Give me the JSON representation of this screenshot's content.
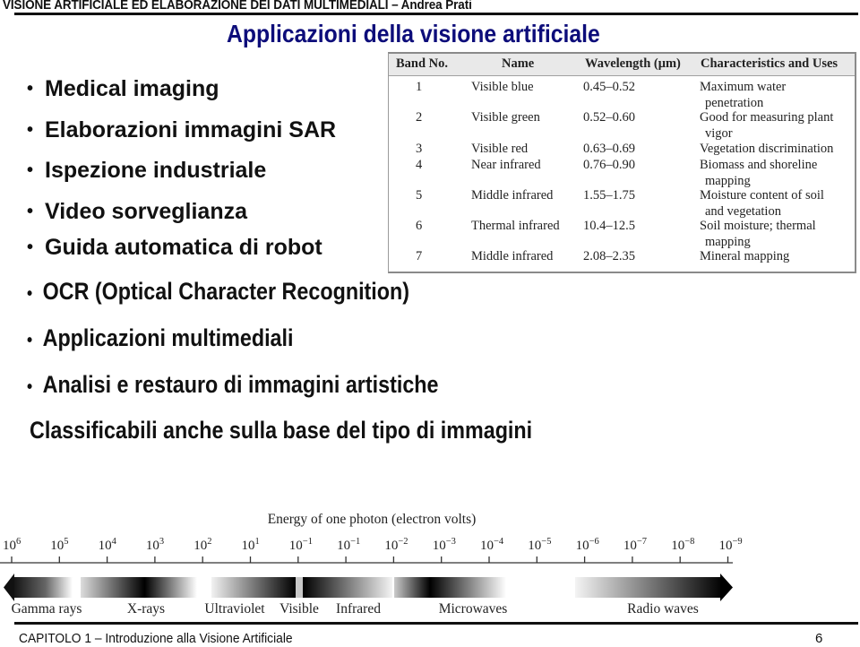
{
  "header": {
    "course_title": "VISIONE ARTIFICIALE ED ELABORAZIONE DEI DATI MULTIMEDIALI – Andrea Prati"
  },
  "slide": {
    "title": "Applicazioni della visione artificiale",
    "bullets_top": [
      "Medical imaging",
      "Elaborazioni immagini SAR",
      "Ispezione industriale",
      "Video sorveglianza",
      "Guida automatica di robot"
    ],
    "bullets_bottom": [
      "OCR (Optical Character Recognition)",
      "Applicazioni multimediali",
      "Analisi e restauro di immagini artistiche"
    ],
    "classification_note": "Classificabili anche sulla base del tipo di immagini",
    "bullet_glyph": "•"
  },
  "band_table": {
    "columns": [
      "Band No.",
      "Name",
      "Wavelength (μm)",
      "Characteristics and Uses"
    ],
    "rows": [
      {
        "band": "1",
        "name": "Visible blue",
        "wavelength": "0.45–0.52",
        "use": [
          "Maximum water",
          "penetration"
        ]
      },
      {
        "band": "2",
        "name": "Visible green",
        "wavelength": "0.52–0.60",
        "use": [
          "Good for measuring plant",
          "vigor"
        ]
      },
      {
        "band": "3",
        "name": "Visible red",
        "wavelength": "0.63–0.69",
        "use": [
          "Vegetation discrimination"
        ]
      },
      {
        "band": "4",
        "name": "Near infrared",
        "wavelength": "0.76–0.90",
        "use": [
          "Biomass and shoreline",
          "mapping"
        ]
      },
      {
        "band": "5",
        "name": "Middle infrared",
        "wavelength": "1.55–1.75",
        "use": [
          "Moisture content of soil",
          "and vegetation"
        ]
      },
      {
        "band": "6",
        "name": "Thermal infrared",
        "wavelength": "10.4–12.5",
        "use": [
          "Soil moisture; thermal",
          "mapping"
        ]
      },
      {
        "band": "7",
        "name": "Middle infrared",
        "wavelength": "2.08–2.35",
        "use": [
          "Mineral mapping"
        ]
      }
    ]
  },
  "spectrum": {
    "title": "Energy of one photon (electron volts)",
    "ticks": [
      {
        "base": "10",
        "exp": "6"
      },
      {
        "base": "10",
        "exp": "5"
      },
      {
        "base": "10",
        "exp": "4"
      },
      {
        "base": "10",
        "exp": "3"
      },
      {
        "base": "10",
        "exp": "2"
      },
      {
        "base": "10",
        "exp": "1"
      },
      {
        "base": "10",
        "exp": "−1"
      },
      {
        "base": "10",
        "exp": "−1"
      },
      {
        "base": "10",
        "exp": "−2"
      },
      {
        "base": "10",
        "exp": "−3"
      },
      {
        "base": "10",
        "exp": "−4"
      },
      {
        "base": "10",
        "exp": "−5"
      },
      {
        "base": "10",
        "exp": "−6"
      },
      {
        "base": "10",
        "exp": "−7"
      },
      {
        "base": "10",
        "exp": "−8"
      },
      {
        "base": "10",
        "exp": "−9"
      }
    ],
    "regions": [
      "Gamma rays",
      "X-rays",
      "Ultraviolet",
      "Visible",
      "Infrared",
      "Microwaves",
      "Radio waves"
    ]
  },
  "footer": {
    "chapter": "CAPITOLO 1 – Introduzione alla Visione Artificiale",
    "page_number": "6"
  }
}
